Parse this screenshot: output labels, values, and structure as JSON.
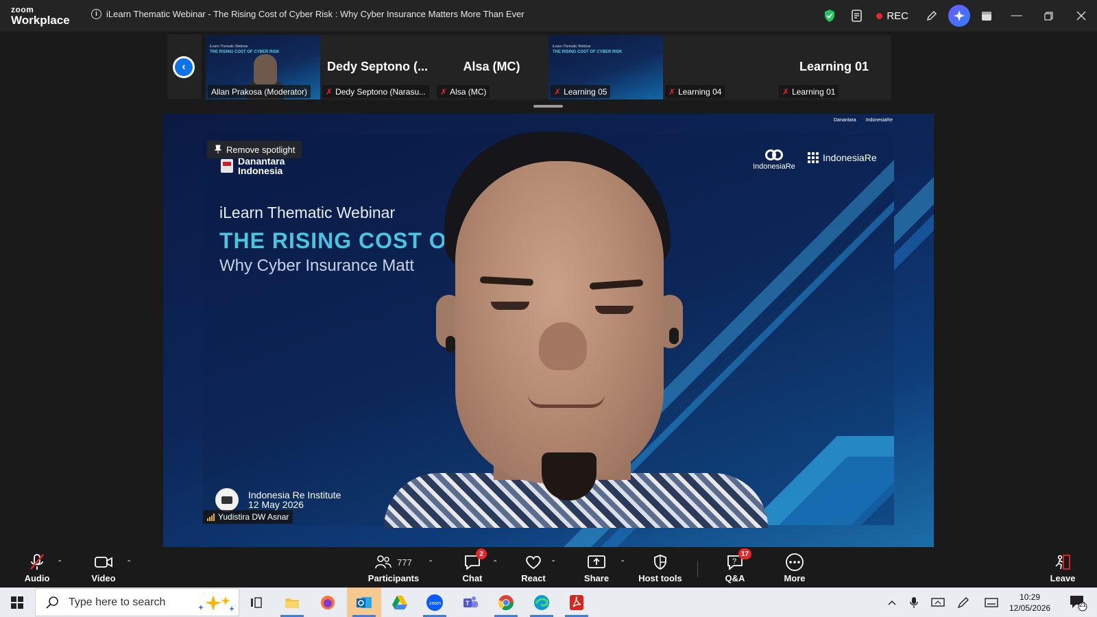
{
  "app": {
    "logo_line1": "zoom",
    "logo_line2": "Workplace",
    "meeting_title": "iLearn Thematic Webinar - The Rising Cost of Cyber Risk : Why Cyber Insurance Matters More Than Ever",
    "rec_label": "REC",
    "colors": {
      "titlebar": "#242424",
      "accent": "#0e72ed",
      "rec": "#e8262b",
      "shield": "#23c55e"
    }
  },
  "thumbnails": [
    {
      "label": "Allan Prakosa (Moderator)",
      "big_name": "",
      "type": "video",
      "muted": false
    },
    {
      "label": "Dedy Septono (Narasu...",
      "big_name": "Dedy Septono (...",
      "type": "name",
      "muted": true
    },
    {
      "label": "Alsa (MC)",
      "big_name": "Alsa (MC)",
      "type": "name",
      "muted": true
    },
    {
      "label": "Learning 05",
      "big_name": "",
      "type": "slide",
      "muted": true
    },
    {
      "label": "Learning 04",
      "big_name": "",
      "type": "blank",
      "muted": true
    },
    {
      "label": "Learning 01",
      "big_name": "Learning 01",
      "type": "name",
      "muted": true
    }
  ],
  "thumb_slide": {
    "mini_head": "iLearn Thematic Webinar",
    "mini_title": "THE RISING COST OF CYBER RISK"
  },
  "stage": {
    "spotlight_label": "Remove spotlight",
    "org_line1": "Danantara",
    "org_line2": "Indonesia",
    "slide_subtitle": "iLearn Thematic Webinar",
    "slide_title": "THE RISING COST O",
    "slide_tagline": "Why Cyber Insurance Matt",
    "logo_re": "IndonesiaRe",
    "logo_institute": "IndonesiaRe",
    "watermark_line1": "Indonesia Re Institute",
    "watermark_line2": "12 May 2026",
    "speaker_name": "Yudistira DW Asnar"
  },
  "toolbar": {
    "audio": "Audio",
    "video": "Video",
    "participants": "Participants",
    "participants_count": "777",
    "chat": "Chat",
    "chat_badge": "2",
    "react": "React",
    "share": "Share",
    "host_tools": "Host tools",
    "qa": "Q&A",
    "qa_badge": "17",
    "more": "More",
    "leave": "Leave"
  },
  "taskbar": {
    "search_placeholder": "Type here to search",
    "time": "10:29",
    "date": "12/05/2026",
    "notif_count": "21",
    "apps": [
      "task-view",
      "file-explorer",
      "firefox",
      "outlook",
      "google-drive",
      "zoom",
      "teams",
      "chrome",
      "edge",
      "acrobat"
    ]
  }
}
